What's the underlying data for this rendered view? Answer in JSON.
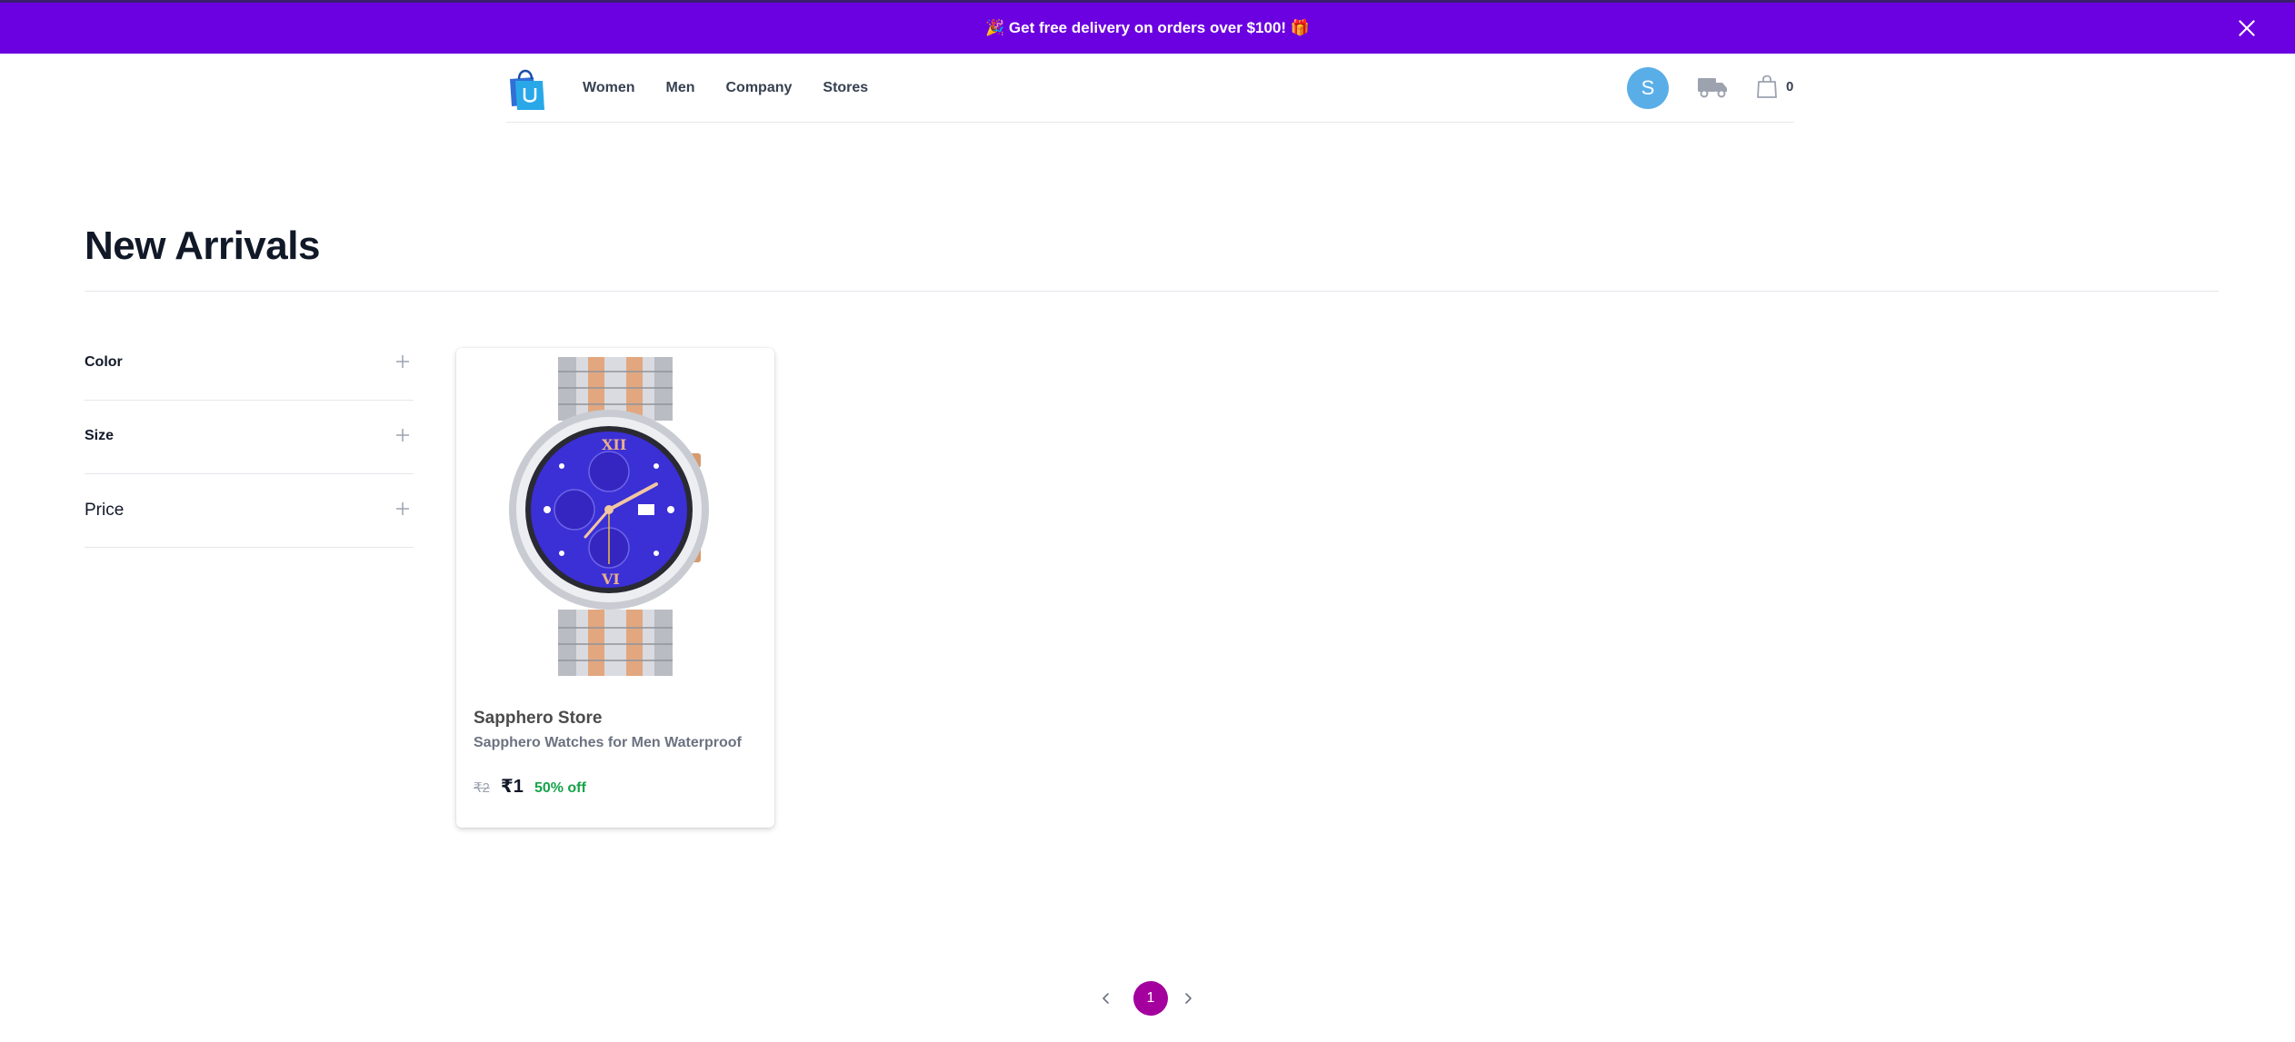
{
  "promo": {
    "text": "🎉 Get free delivery on orders over $100! 🎁",
    "background_color": "#6b00e0",
    "close_icon": "close-icon"
  },
  "navbar": {
    "logo_icon": "shopping-bag-logo-icon",
    "links": [
      "Women",
      "Men",
      "Company",
      "Stores"
    ],
    "avatar_initial": "S",
    "avatar_color": "#5aaee8",
    "delivery_icon": "truck-icon",
    "cart_icon": "bag-icon",
    "cart_count": "0"
  },
  "page": {
    "title": "New Arrivals"
  },
  "filters": [
    {
      "label": "Color",
      "icon": "plus-icon"
    },
    {
      "label": "Size",
      "icon": "plus-icon"
    },
    {
      "label": "Price",
      "icon": "plus-icon"
    }
  ],
  "products": [
    {
      "brand": "Sapphero Store",
      "name": "Sapphero Watches for Men Waterproof",
      "price_old": "₹2",
      "price_new": "₹1",
      "discount": "50% off",
      "discount_color": "#16a34a",
      "image_icon": "wristwatch-image"
    }
  ],
  "pagination": {
    "current_page": "1",
    "accent_color": "#a3009e",
    "prev_icon": "chevron-left-icon",
    "next_icon": "chevron-right-icon"
  }
}
